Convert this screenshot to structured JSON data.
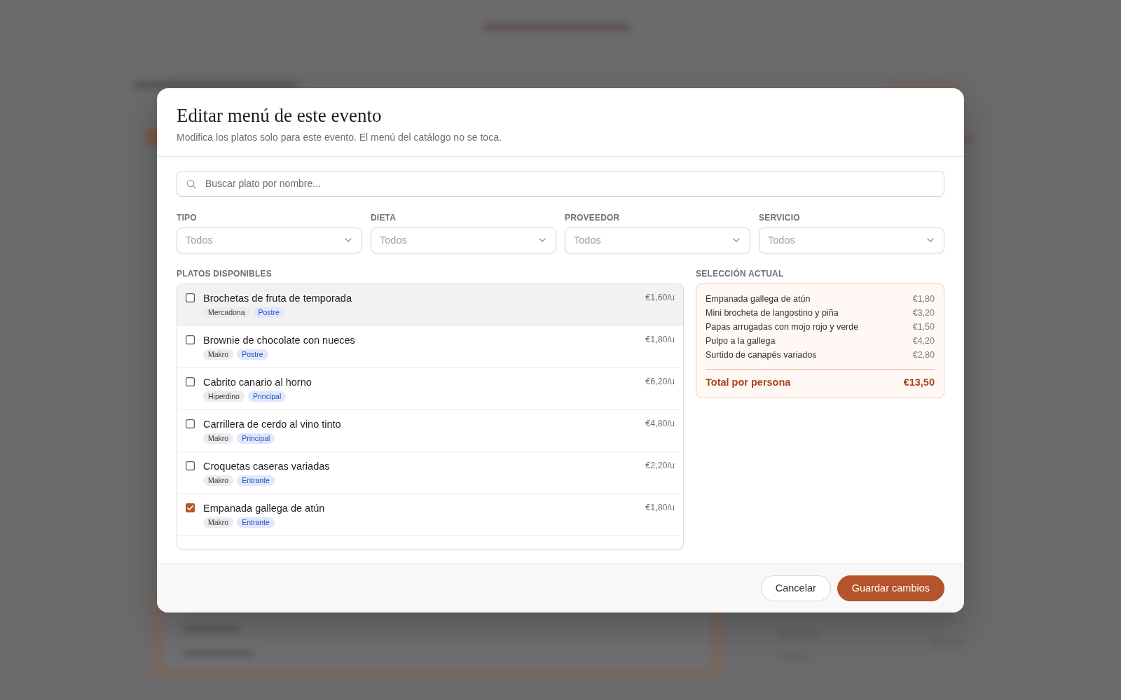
{
  "dialog": {
    "title": "Editar menú de este evento",
    "subtitle": "Modifica los platos solo para este evento. El menú del catálogo no se toca."
  },
  "search": {
    "placeholder": "Buscar plato por nombre..."
  },
  "filters": [
    {
      "label": "TIPO",
      "placeholder": "Todos"
    },
    {
      "label": "DIETA",
      "placeholder": "Todos"
    },
    {
      "label": "PROVEEDOR",
      "placeholder": "Todos"
    },
    {
      "label": "SERVICIO",
      "placeholder": "Todos"
    }
  ],
  "available": {
    "heading": "PLATOS DISPONIBLES",
    "rows": [
      {
        "name": "Brochetas de fruta de temporada",
        "supplier": "Mercadona",
        "category": "Postre",
        "price": "€1,60/u",
        "checked": false,
        "highlighted": true
      },
      {
        "name": "Brownie de chocolate con nueces",
        "supplier": "Makro",
        "category": "Postre",
        "price": "€1,80/u",
        "checked": false,
        "highlighted": false
      },
      {
        "name": "Cabrito canario al horno",
        "supplier": "Hiperdino",
        "category": "Principal",
        "price": "€6,20/u",
        "checked": false,
        "highlighted": false
      },
      {
        "name": "Carrillera de cerdo al vino tinto",
        "supplier": "Makro",
        "category": "Principal",
        "price": "€4,80/u",
        "checked": false,
        "highlighted": false
      },
      {
        "name": "Croquetas caseras variadas",
        "supplier": "Makro",
        "category": "Entrante",
        "price": "€2,20/u",
        "checked": false,
        "highlighted": false
      },
      {
        "name": "Empanada gallega de atún",
        "supplier": "Makro",
        "category": "Entrante",
        "price": "€1,80/u",
        "checked": true,
        "highlighted": false
      }
    ]
  },
  "selection": {
    "heading": "SELECCIÓN ACTUAL",
    "items": [
      {
        "name": "Empanada gallega de atún",
        "price": "€1,80"
      },
      {
        "name": "Mini brocheta de langostino y piña",
        "price": "€3,20"
      },
      {
        "name": "Papas arrugadas con mojo rojo y verde",
        "price": "€1,50"
      },
      {
        "name": "Pulpo a la gallega",
        "price": "€4,20"
      },
      {
        "name": "Surtido de canapés variados",
        "price": "€2,80"
      }
    ],
    "total": {
      "label": "Total por persona",
      "value": "€13,50"
    }
  },
  "buttons": [
    {
      "label": "Cancelar",
      "kind": "secondary"
    },
    {
      "label": "Guardar cambios",
      "kind": "primary"
    }
  ]
}
